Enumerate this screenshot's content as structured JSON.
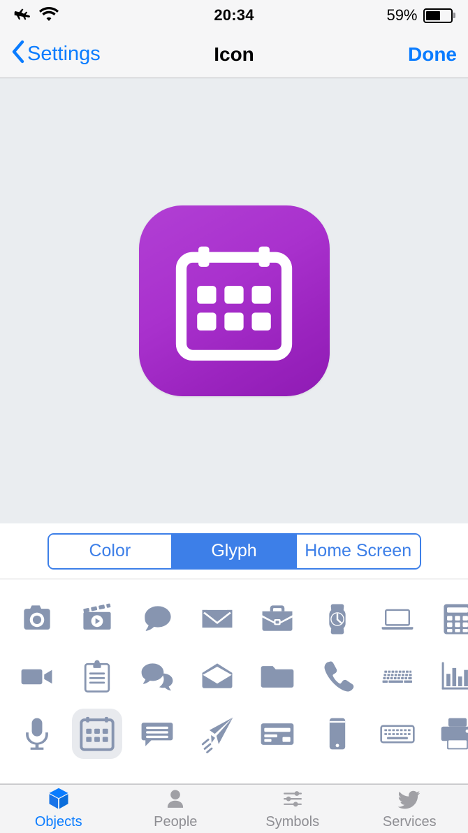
{
  "status_bar": {
    "airplane_icon": "airplane-icon",
    "wifi_icon": "wifi-icon",
    "time": "20:34",
    "battery_percent": "59%",
    "battery_level": 59
  },
  "nav_bar": {
    "back_label": "Settings",
    "back_icon": "chevron-left-icon",
    "title": "Icon",
    "done_label": "Done"
  },
  "preview": {
    "icon_name": "calendar-glyph",
    "background_color": "#eaedf0",
    "gradient_from": "#b13fd4",
    "gradient_to": "#8f1bb4",
    "glyph_color": "#ffffff"
  },
  "segmented_control": {
    "accent_color": "#3d7fe8",
    "selected": "Glyph",
    "options": [
      {
        "label": "Color",
        "selected": false
      },
      {
        "label": "Glyph",
        "selected": true
      },
      {
        "label": "Home Screen",
        "selected": false
      }
    ]
  },
  "glyph_grid": {
    "glyph_color": "#8795b0",
    "selected_background": "#e8eaee",
    "columns": 8,
    "selected_glyph": "calendar-icon",
    "items": [
      {
        "name": "camera-icon",
        "selected": false
      },
      {
        "name": "clapperboard-video-icon",
        "selected": false
      },
      {
        "name": "speech-bubble-icon",
        "selected": false
      },
      {
        "name": "envelope-closed-icon",
        "selected": false
      },
      {
        "name": "briefcase-icon",
        "selected": false
      },
      {
        "name": "watch-icon",
        "selected": false
      },
      {
        "name": "laptop-icon",
        "selected": false
      },
      {
        "name": "calculator-icon",
        "selected": false
      },
      {
        "name": "video-camera-icon",
        "selected": false
      },
      {
        "name": "clipboard-icon",
        "selected": false
      },
      {
        "name": "double-speech-bubble-icon",
        "selected": false
      },
      {
        "name": "envelope-open-icon",
        "selected": false
      },
      {
        "name": "folder-icon",
        "selected": false
      },
      {
        "name": "phone-handset-icon",
        "selected": false
      },
      {
        "name": "keyboard-perspective-icon",
        "selected": false
      },
      {
        "name": "bar-chart-icon",
        "selected": false
      },
      {
        "name": "microphone-icon",
        "selected": false
      },
      {
        "name": "calendar-icon",
        "selected": true
      },
      {
        "name": "chat-lines-icon",
        "selected": false
      },
      {
        "name": "paper-plane-icon",
        "selected": false
      },
      {
        "name": "credit-card-icon",
        "selected": false
      },
      {
        "name": "smartphone-icon",
        "selected": false
      },
      {
        "name": "keyboard-outline-icon",
        "selected": false
      },
      {
        "name": "printer-icon",
        "selected": false
      }
    ]
  },
  "tab_bar": {
    "active_color": "#0a7cff",
    "inactive_color": "#8e8e93",
    "tabs": [
      {
        "label": "Objects",
        "icon": "cube-icon",
        "active": true
      },
      {
        "label": "People",
        "icon": "person-icon",
        "active": false
      },
      {
        "label": "Symbols",
        "icon": "sliders-icon",
        "active": false
      },
      {
        "label": "Services",
        "icon": "bird-icon",
        "active": false
      }
    ]
  }
}
